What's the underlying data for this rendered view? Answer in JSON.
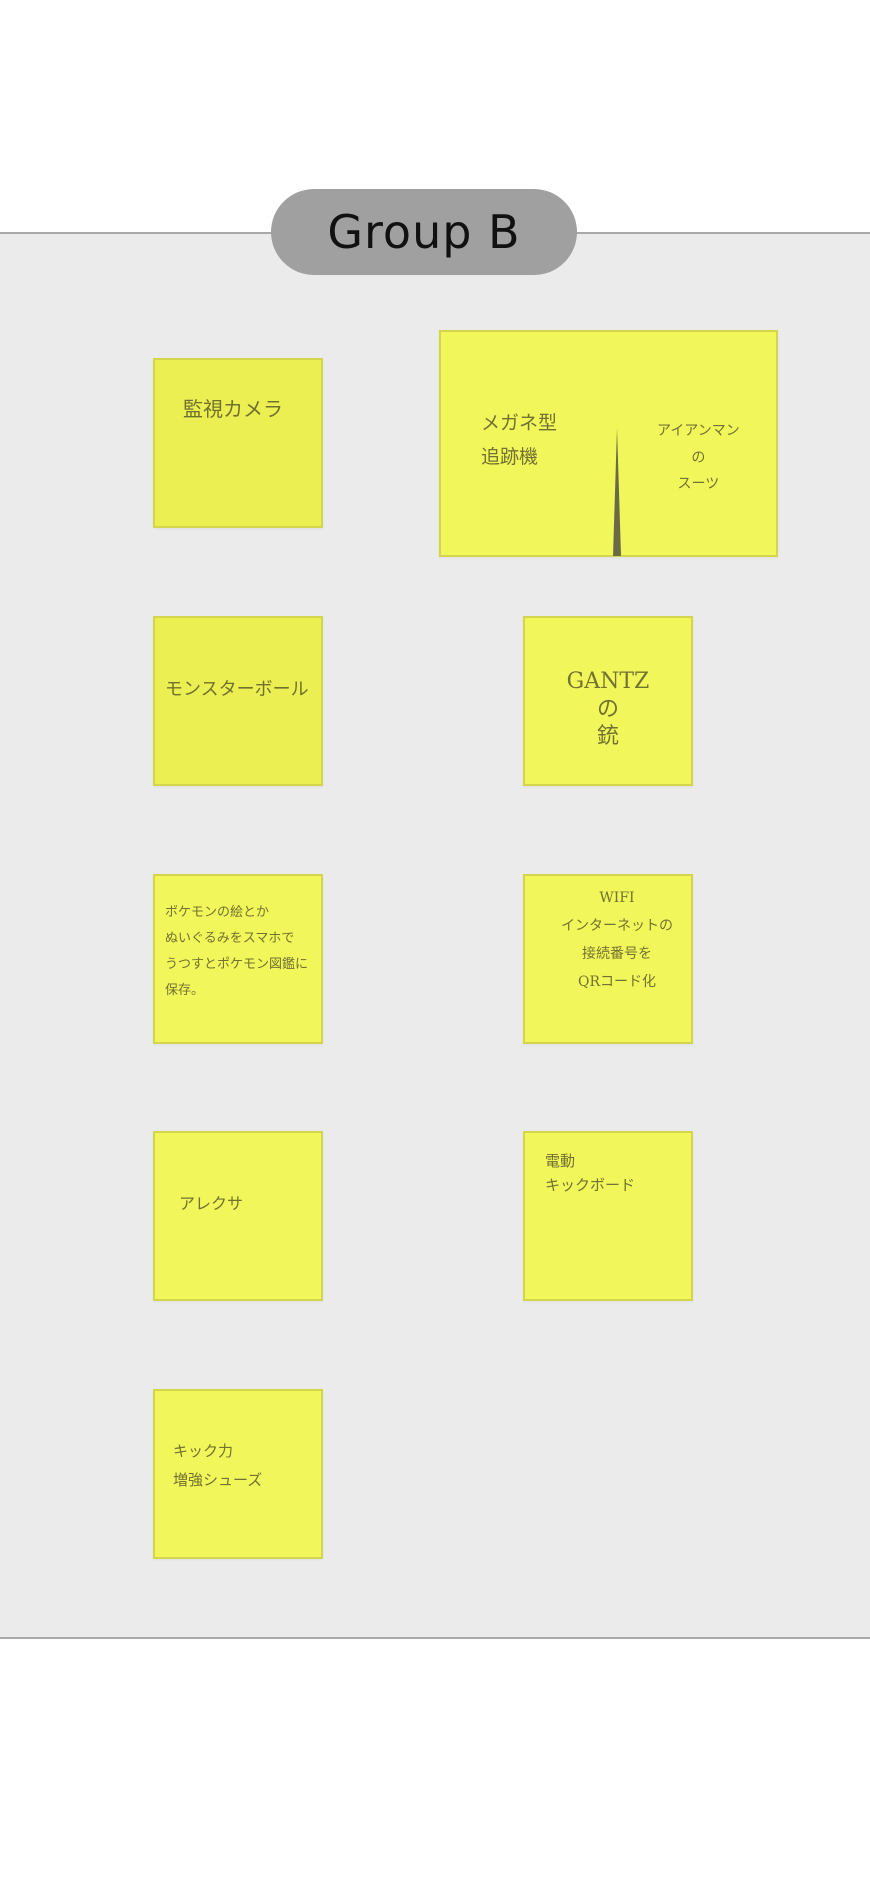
{
  "board": {
    "group_label": "Group B",
    "background_color": "#ebebeb",
    "pill_color": "#a0a0a0",
    "note_color": "#ecef52"
  },
  "notes": [
    {
      "id": "note-1",
      "text": "監視カメラ"
    },
    {
      "id": "note-2a",
      "text": "メガネ型\n追跡機"
    },
    {
      "id": "note-2b",
      "text": "アイアンマン\nの\nスーツ"
    },
    {
      "id": "note-3",
      "text": "モンスターボール"
    },
    {
      "id": "note-4",
      "text": "GANTZ\nの\n銃"
    },
    {
      "id": "note-5",
      "text": "ポケモンの絵とか\nぬいぐるみをスマホで\nうつすとポケモン図鑑に\n保存。"
    },
    {
      "id": "note-6",
      "text": "WIFI\nインターネットの\n接続番号を\nQRコード化"
    },
    {
      "id": "note-7",
      "text": "アレクサ"
    },
    {
      "id": "note-8",
      "text": "電動\nキックボード"
    },
    {
      "id": "note-9",
      "text": "キック力\n増強シューズ"
    }
  ]
}
